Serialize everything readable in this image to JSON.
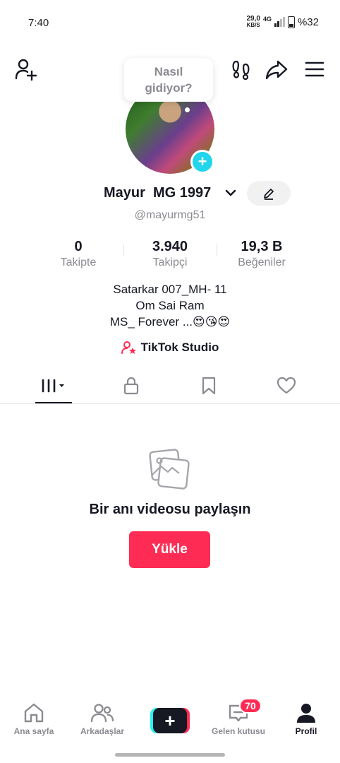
{
  "status_bar": {
    "time": "7:40",
    "net_speed_value": "29,0",
    "net_speed_unit": "KB/S",
    "network": "4G",
    "battery": "%32"
  },
  "tooltip": {
    "line1": "Nasıl",
    "line2": "gidiyor?"
  },
  "profile": {
    "display_name": "Mayur  MG 1997",
    "username": "@mayurmg51",
    "stats": [
      {
        "value": "0",
        "label": "Takipte"
      },
      {
        "value": "3.940",
        "label": "Takipçi"
      },
      {
        "value": "19,3 B",
        "label": "Beğeniler"
      }
    ],
    "bio": [
      "Satarkar 007_MH- 11",
      "Om Sai Ram",
      "MS_ Forever ...😍😘😍"
    ],
    "studio_link": "TikTok Studio"
  },
  "empty_state": {
    "title": "Bir anı videosu paylaşın",
    "upload_label": "Yükle"
  },
  "bottom_nav": {
    "home": "Ana sayfa",
    "friends": "Arkadaşlar",
    "inbox": "Gelen kutusu",
    "inbox_badge": "70",
    "profile": "Profil"
  },
  "colors": {
    "accent": "#fe2c55",
    "cyan": "#25f4ee",
    "avatar_add": "#20d5ec",
    "text": "#161823",
    "muted": "#8a8b91"
  }
}
